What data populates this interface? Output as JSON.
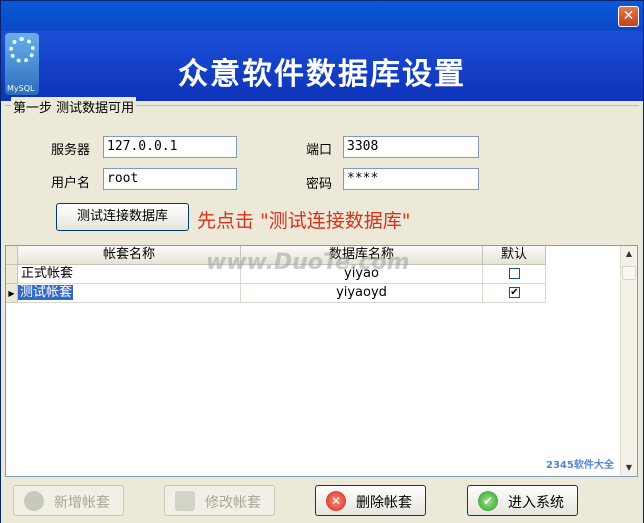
{
  "window": {
    "close_glyph": "✕"
  },
  "banner": {
    "title": "众意软件数据库设置",
    "logo_text": "MySQL"
  },
  "step": {
    "legend": "第一步 测试数据可用",
    "server_label": "服务器",
    "server_value": "127.0.0.1",
    "port_label": "端口",
    "port_value": "3308",
    "user_label": "用户名",
    "user_value": "root",
    "password_label": "密码",
    "password_value": "****",
    "test_button": "测试连接数据库",
    "hint": "先点击 \"测试连接数据库\""
  },
  "grid": {
    "columns": [
      "帐套名称",
      "数据库名称",
      "默认"
    ],
    "rows": [
      {
        "name": "正式帐套",
        "db": "yiyao",
        "default": false
      },
      {
        "name": "测试帐套",
        "db": "yiyaoyd",
        "default": true
      }
    ],
    "selected_row": 1,
    "row_indicator": "▶",
    "scroll_up": "▲",
    "scroll_down": "▼"
  },
  "watermark": "www.DuoTe.com",
  "watermark2": "2345软件大全",
  "buttons": {
    "add": "新增帐套",
    "edit": "修改帐套",
    "delete": "删除帐套",
    "enter": "进入系统"
  },
  "colors": {
    "banner": "#1c4fd8",
    "hint": "#d8331c",
    "selection": "#316ac5"
  }
}
